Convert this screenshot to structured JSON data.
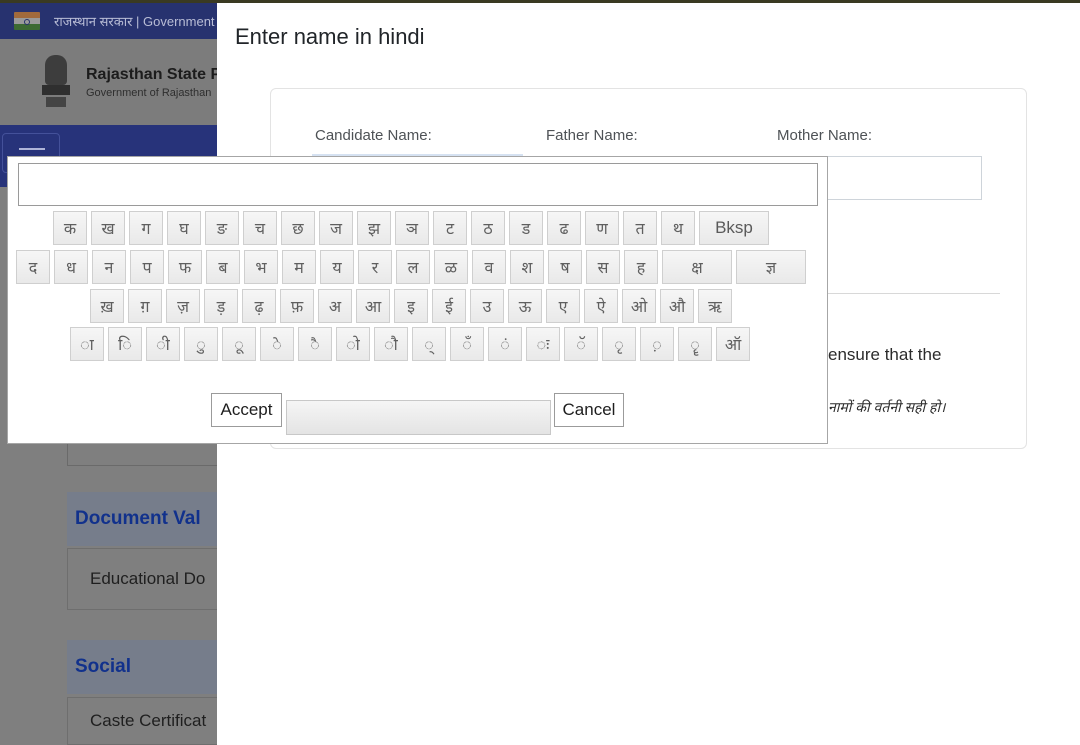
{
  "page": {
    "gov_bar_text": "राजस्थान सरकार | Government",
    "org_name": "Rajasthan State P",
    "org_sub": "Government of Rajasthan"
  },
  "background_sections": [
    {
      "heading": "Document Val",
      "item": "Educational Do"
    },
    {
      "heading": "Social",
      "item": "Caste Certificat"
    }
  ],
  "modal": {
    "title": "Enter name in hindi",
    "labels": {
      "candidate": "Candidate Name:",
      "father": "Father Name:",
      "mother": "Mother Name:"
    },
    "note": "ensure that the",
    "note_hindi": "नामों की वर्तनी सही हो।"
  },
  "keyboard": {
    "input_value": "",
    "rows": [
      [
        "क",
        "ख",
        "ग",
        "घ",
        "ङ",
        "च",
        "छ",
        "ज",
        "झ",
        "ञ",
        "ट",
        "ठ",
        "ड",
        "ढ",
        "ण",
        "त",
        "थ"
      ],
      [
        "द",
        "ध",
        "न",
        "प",
        "फ",
        "ब",
        "भ",
        "म",
        "य",
        "र",
        "ल",
        "ळ",
        "व",
        "श",
        "ष",
        "स",
        "ह",
        "क्ष",
        "ज्ञ"
      ],
      [
        "ख़",
        "ग़",
        "ज़",
        "ड़",
        "ढ़",
        "फ़",
        "अ",
        "आ",
        "इ",
        "ई",
        "उ",
        "ऊ",
        "ए",
        "ऐ",
        "ओ",
        "औ",
        "ऋ"
      ],
      [
        "ा",
        "ि",
        "ी",
        "ु",
        "ू",
        "े",
        "ै",
        "ो",
        "ौ",
        "्",
        "ँ",
        "ं",
        "ः",
        "ॅ",
        "ृ",
        "़",
        "ॄ",
        "ऑ"
      ]
    ],
    "backspace_label": "Bksp",
    "accept_label": "Accept",
    "cancel_label": "Cancel"
  }
}
